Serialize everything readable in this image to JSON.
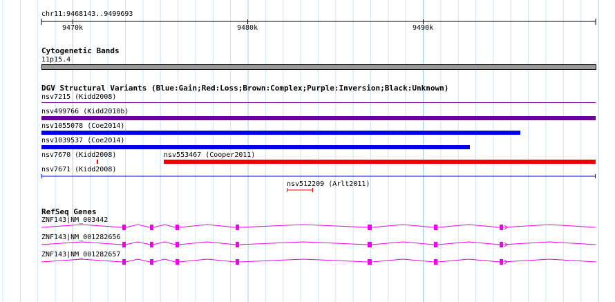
{
  "ruler": {
    "locus": "chr11:9468143..9499693",
    "ticks": [
      "9470k",
      "9480k",
      "9490k"
    ]
  },
  "tracks": {
    "cyto": {
      "title": "Cytogenetic Bands",
      "band": "11p15.4"
    },
    "dgv": {
      "title": "DGV Structural Variants (Blue:Gain;Red:Loss;Brown:Complex;Purple:Inversion;Black:Unknown)",
      "features": [
        {
          "label": "nsv7215 (Kidd2008)",
          "type": "Inversion",
          "color": "#660099"
        },
        {
          "label": "nsv499766 (Kidd2010b)",
          "type": "Inversion",
          "color": "#660099"
        },
        {
          "label": "nsv1055078 (Coe2014)",
          "type": "Gain",
          "color": "#0000ee"
        },
        {
          "label": "nsv1039537 (Coe2014)",
          "type": "Gain",
          "color": "#0000ee"
        },
        {
          "label": "nsv7670 (Kidd2008)",
          "type": "Loss",
          "color": "#ee0000"
        },
        {
          "label": "nsv553467 (Cooper2011)",
          "type": "Loss",
          "color": "#ee0000"
        },
        {
          "label": "nsv7671 (Kidd2008)",
          "type": "Gain",
          "color": "#0000ee"
        },
        {
          "label": "nsv512209 (Arlt2011)",
          "type": "Loss",
          "color": "#ee0000"
        }
      ]
    },
    "refseq": {
      "title": "RefSeq Genes",
      "color": "#ee00ee",
      "transcripts": [
        "ZNF143|NM_003442",
        "ZNF143|NM_001282656",
        "ZNF143|NM_001282657"
      ]
    }
  }
}
